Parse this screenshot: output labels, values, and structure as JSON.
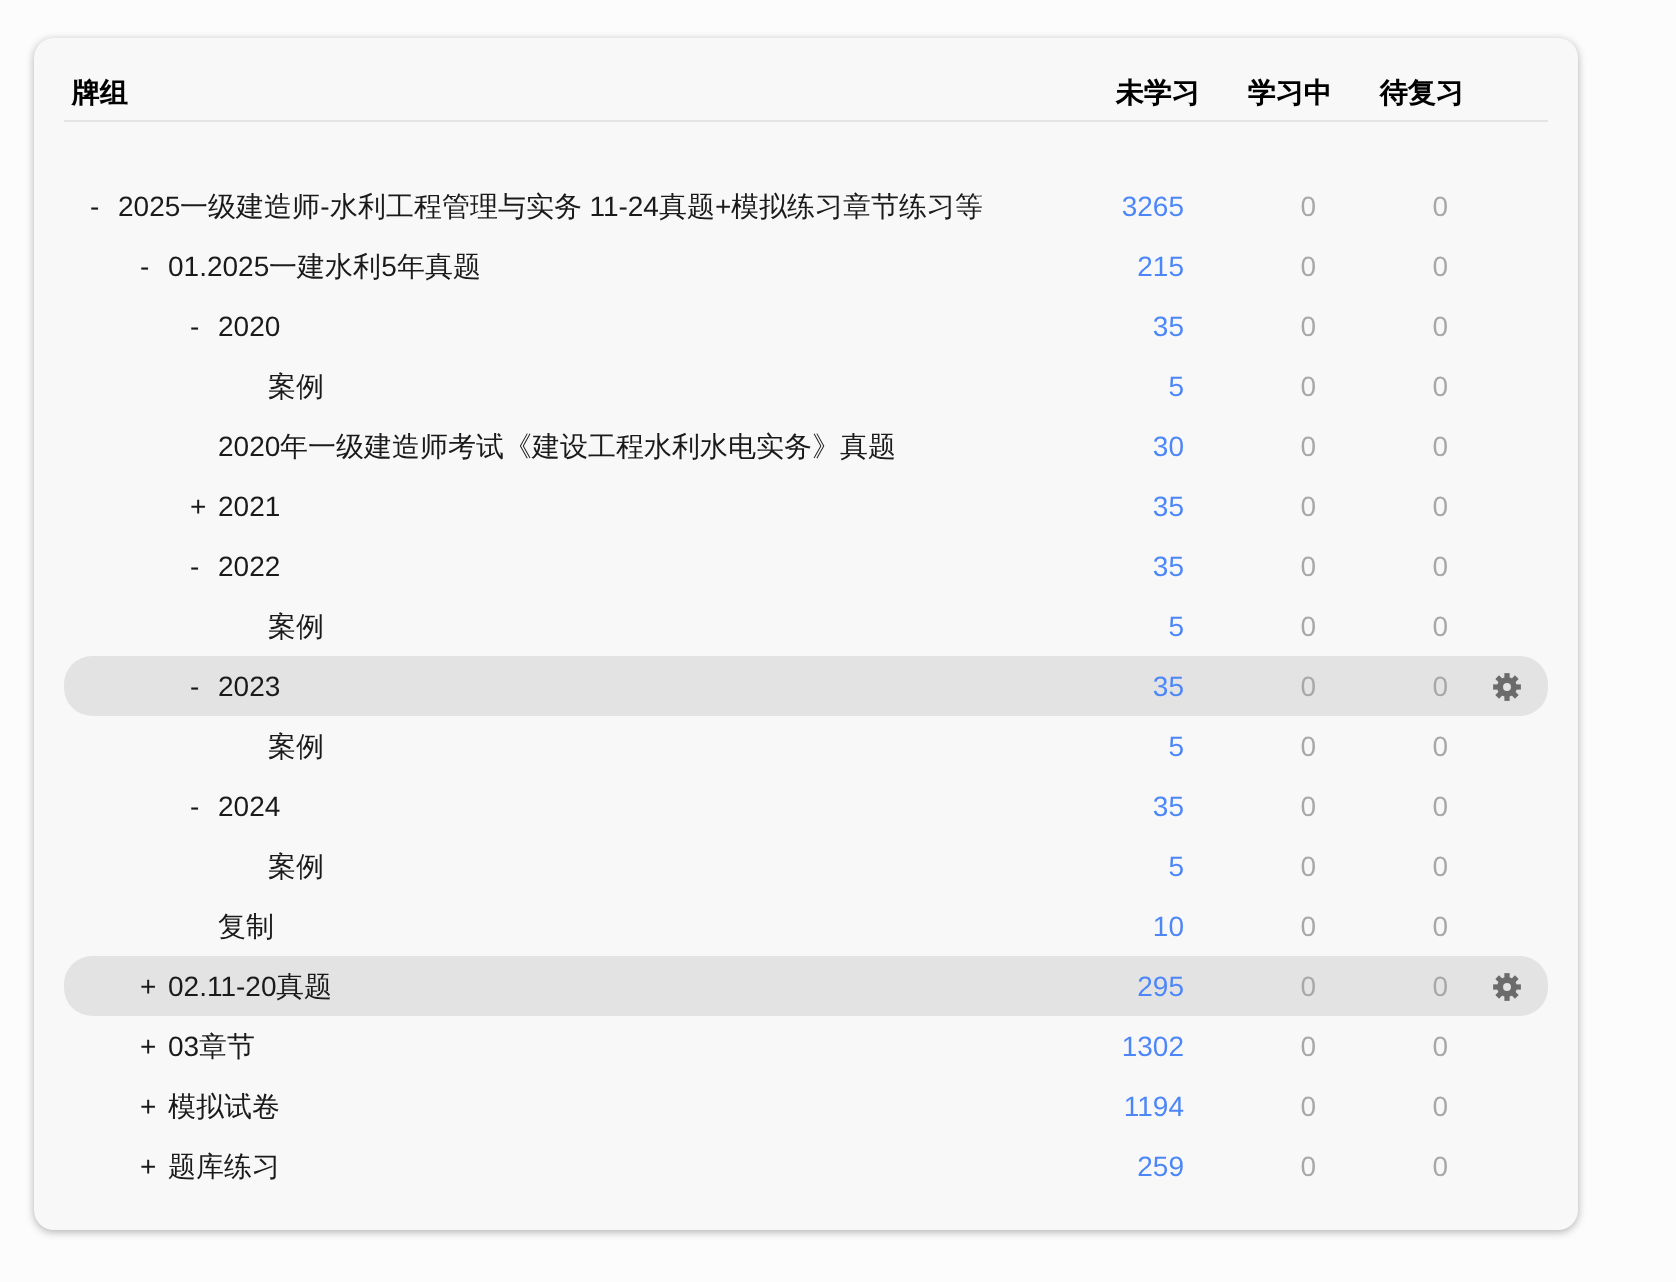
{
  "table": {
    "columns": [
      "牌组",
      "未学习",
      "学习中",
      "待复习"
    ],
    "rows": [
      {
        "toggle": "-",
        "name": "2025一级建造师-水利工程管理与实务 11-24真题+模拟练习章节练习等",
        "new": "3265",
        "learn": "0",
        "due": "0",
        "selected": false,
        "children": [
          {
            "toggle": "-",
            "name": "01.2025一建水利5年真题",
            "new": "215",
            "learn": "0",
            "due": "0",
            "selected": false,
            "children": [
              {
                "toggle": "-",
                "name": "2020",
                "new": "35",
                "learn": "0",
                "due": "0",
                "selected": false,
                "children": [
                  {
                    "name": "案例",
                    "new": "5",
                    "learn": "0",
                    "due": "0",
                    "selected": false
                  }
                ]
              },
              {
                "name": "2020年一级建造师考试《建设工程水利水电实务》真题",
                "new": "30",
                "learn": "0",
                "due": "0",
                "selected": false
              },
              {
                "toggle": "+",
                "name": "2021",
                "new": "35",
                "learn": "0",
                "due": "0",
                "selected": false
              },
              {
                "toggle": "-",
                "name": "2022",
                "new": "35",
                "learn": "0",
                "due": "0",
                "selected": false,
                "children": [
                  {
                    "name": "案例",
                    "new": "5",
                    "learn": "0",
                    "due": "0",
                    "selected": false
                  }
                ]
              },
              {
                "toggle": "-",
                "name": "2023",
                "new": "35",
                "learn": "0",
                "due": "0",
                "selected": true,
                "children": [
                  {
                    "name": "案例",
                    "new": "5",
                    "learn": "0",
                    "due": "0",
                    "selected": false
                  }
                ]
              },
              {
                "toggle": "-",
                "name": "2024",
                "new": "35",
                "learn": "0",
                "due": "0",
                "selected": false,
                "children": [
                  {
                    "name": "案例",
                    "new": "5",
                    "learn": "0",
                    "due": "0",
                    "selected": false
                  }
                ]
              },
              {
                "name": "复制",
                "new": "10",
                "learn": "0",
                "due": "0",
                "selected": false
              }
            ]
          },
          {
            "toggle": "+",
            "name": "02.11-20真题",
            "new": "295",
            "learn": "0",
            "due": "0",
            "selected": true
          },
          {
            "toggle": "+",
            "name": "03章节",
            "new": "1302",
            "learn": "0",
            "due": "0",
            "selected": false
          },
          {
            "toggle": "+",
            "name": "模拟试卷",
            "new": "1194",
            "learn": "0",
            "due": "0",
            "selected": false
          },
          {
            "toggle": "+",
            "name": "题库练习",
            "new": "259",
            "learn": "0",
            "due": "0",
            "selected": false
          }
        ]
      }
    ]
  }
}
